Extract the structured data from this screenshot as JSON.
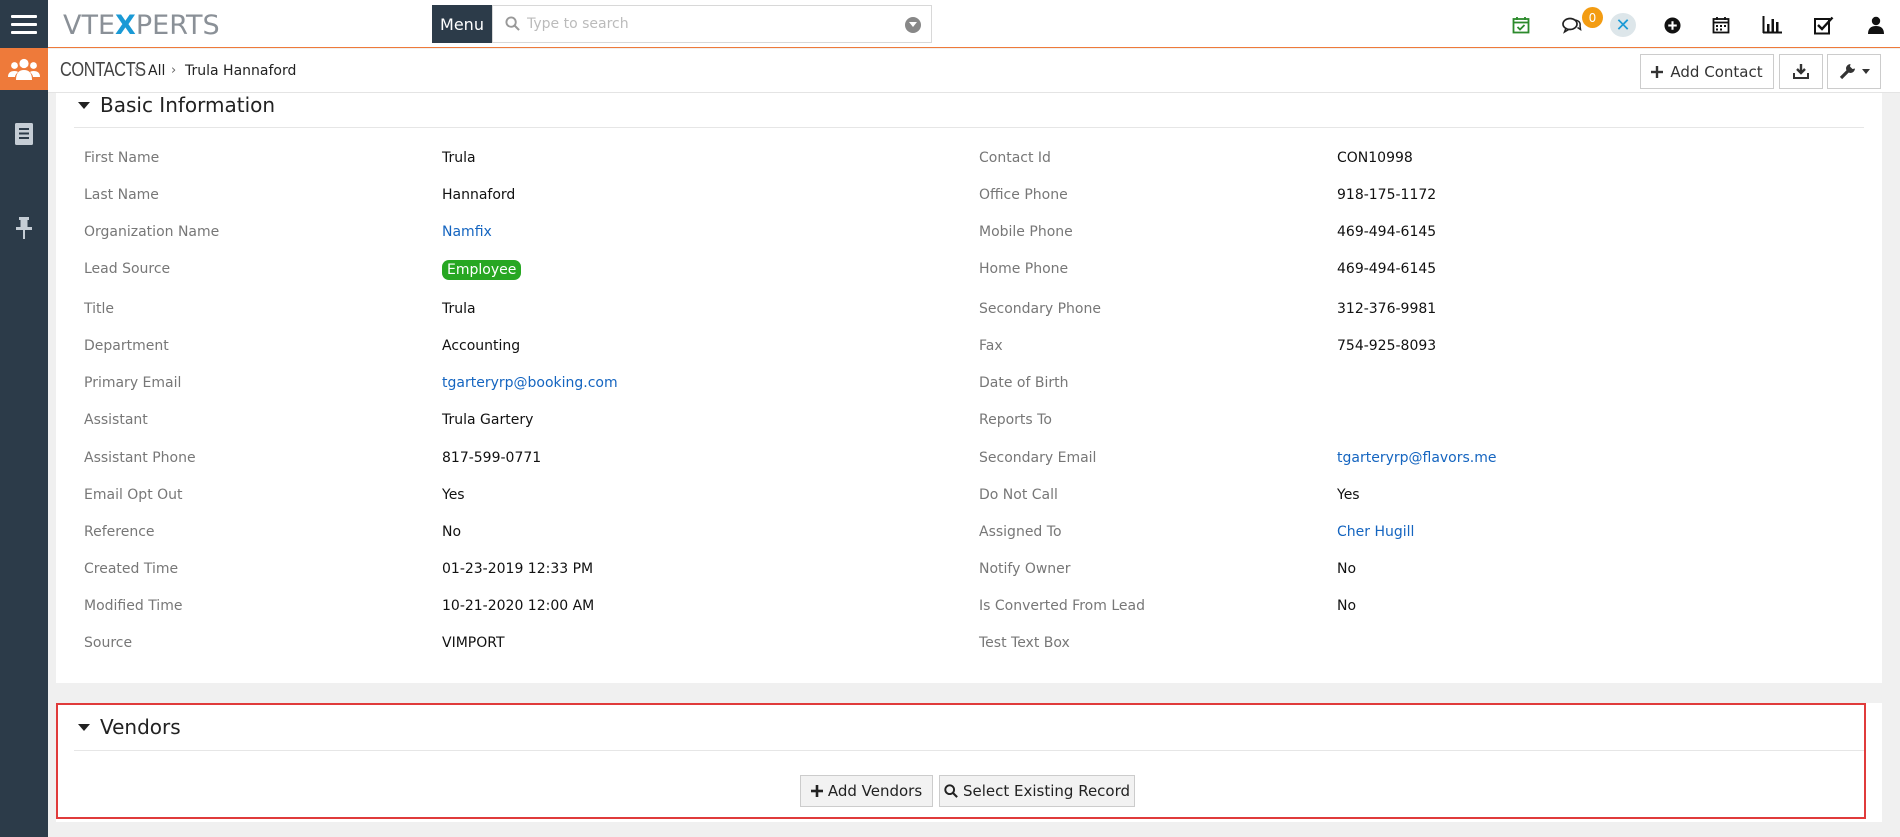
{
  "topbar": {
    "logo_left": "VTE",
    "logo_x": "X",
    "logo_right": "PERTS",
    "menu_label": "Menu",
    "search_placeholder": "Type to search",
    "notification_count": "0",
    "icons": [
      "hamburger-icon",
      "search-icon",
      "dropdown-icon",
      "calendar-check-icon",
      "chat-icon",
      "vtexperts-icon",
      "plus-circle-icon",
      "calendar-icon",
      "bar-chart-icon",
      "checkbox-icon",
      "user-icon"
    ]
  },
  "sidebar": {
    "icons": [
      "contacts-icon",
      "document-icon",
      "pin-icon"
    ]
  },
  "breadcrumb": {
    "module": "CONTACTS",
    "filter": "All",
    "record": "Trula Hannaford"
  },
  "actions": {
    "add_contact": "Add Contact"
  },
  "basic_info": {
    "title": "Basic Information",
    "left": [
      {
        "label": "First Name",
        "value": "Trula"
      },
      {
        "label": "Last Name",
        "value": "Hannaford"
      },
      {
        "label": "Organization Name",
        "value": "Namfix"
      },
      {
        "label": "Lead Source",
        "value": "Employee"
      },
      {
        "label": "Title",
        "value": "Trula"
      },
      {
        "label": "Department",
        "value": "Accounting"
      },
      {
        "label": "Primary Email",
        "value": "tgarteryrp@booking.com"
      },
      {
        "label": "Assistant",
        "value": "Trula Gartery"
      },
      {
        "label": "Assistant Phone",
        "value": "817-599-0771"
      },
      {
        "label": "Email Opt Out",
        "value": "Yes"
      },
      {
        "label": "Reference",
        "value": "No"
      },
      {
        "label": "Created Time",
        "value": "01-23-2019 12:33 PM"
      },
      {
        "label": "Modified Time",
        "value": "10-21-2020 12:00 AM"
      },
      {
        "label": "Source",
        "value": "VIMPORT"
      }
    ],
    "right": [
      {
        "label": "Contact Id",
        "value": "CON10998"
      },
      {
        "label": "Office Phone",
        "value": "918-175-1172"
      },
      {
        "label": "Mobile Phone",
        "value": "469-494-6145"
      },
      {
        "label": "Home Phone",
        "value": "469-494-6145"
      },
      {
        "label": "Secondary Phone",
        "value": "312-376-9981"
      },
      {
        "label": "Fax",
        "value": "754-925-8093"
      },
      {
        "label": "Date of Birth",
        "value": ""
      },
      {
        "label": "Reports To",
        "value": ""
      },
      {
        "label": "Secondary Email",
        "value": "tgarteryrp@flavors.me"
      },
      {
        "label": "Do Not Call",
        "value": "Yes"
      },
      {
        "label": "Assigned To",
        "value": "Cher Hugill"
      },
      {
        "label": "Notify Owner",
        "value": "No"
      },
      {
        "label": "Is Converted From Lead",
        "value": "No"
      },
      {
        "label": "Test Text Box",
        "value": ""
      }
    ]
  },
  "vendors": {
    "title": "Vendors",
    "add_label": "Add Vendors",
    "select_label": "Select Existing Record"
  },
  "colors": {
    "sidebar": "#2c3b49",
    "accent": "#ee7a3a",
    "link": "#1565c0",
    "lead_source_pill": "#27a722",
    "highlight": "#e03b3b",
    "badge": "#f39c12"
  }
}
